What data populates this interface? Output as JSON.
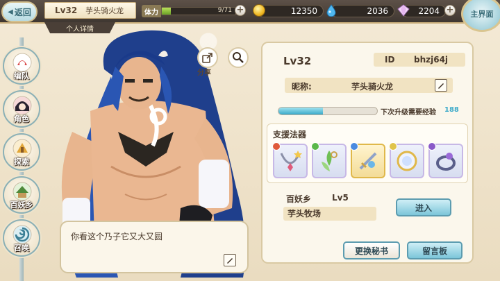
{
  "topbar": {
    "back_label": "返回",
    "level": "Lv32",
    "name": "芋头骑火龙",
    "stamina_label": "体力",
    "stamina_value": "9/71",
    "stamina_fraction": 0.127,
    "coins": "12350",
    "drops": "2036",
    "gems": "2204",
    "main_label": "主界面",
    "detail_tab": "个人详情"
  },
  "sidebar": {
    "items": [
      {
        "label": "编队",
        "icon": "team-icon"
      },
      {
        "label": "角色",
        "icon": "character-icon"
      },
      {
        "label": "探索",
        "icon": "explore-icon"
      },
      {
        "label": "百妖乡",
        "icon": "village-icon"
      },
      {
        "label": "召唤",
        "icon": "summon-icon"
      }
    ]
  },
  "character": {
    "share_label": "分享",
    "speech": "你看这个乃子它又大又圆"
  },
  "panel": {
    "level": "Lv32",
    "id_key": "ID",
    "id_value": "bhzj64j",
    "nick_key": "昵称:",
    "nick_value": "芋头骑火龙",
    "exp_label": "下次升级需要经验",
    "exp_value": "188",
    "exp_fraction": 0.45,
    "support_title": "支援法器",
    "village_name": "百妖乡",
    "village_level": "Lv5",
    "farm_name": "芋头牧场",
    "enter_button": "进入",
    "change_secretary_button": "更换秘书",
    "message_board_button": "留言板"
  },
  "colors": {
    "accent": "#7cc5d9",
    "stamina_fill": "#6aa126",
    "exp_fill": "#3aa9c9",
    "panel_bg": "#fbf7ec"
  }
}
